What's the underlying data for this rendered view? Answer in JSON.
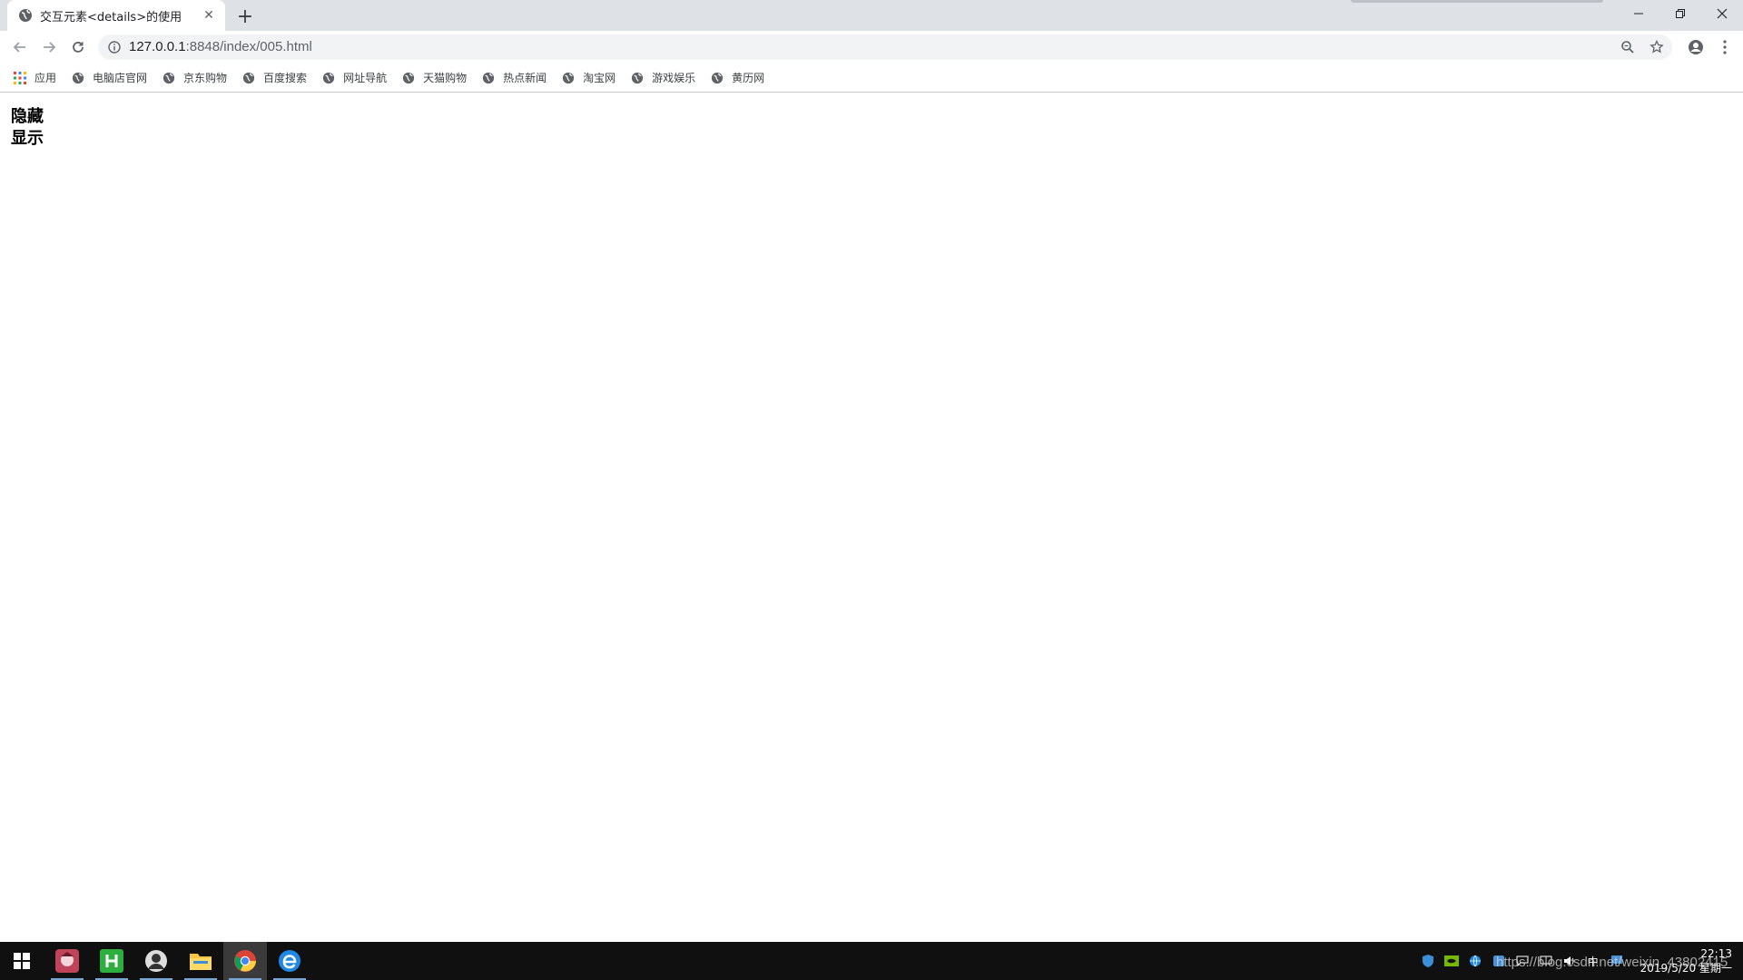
{
  "browser": {
    "tab": {
      "title": "交互元素<details>的使用"
    },
    "address": {
      "host": "127.0.0.1",
      "path": ":8848/index/005.html"
    }
  },
  "bookmarks": [
    {
      "label": "应用",
      "icon": "apps-grid-icon"
    },
    {
      "label": "电脑店官网",
      "icon": "globe-icon"
    },
    {
      "label": "京东购物",
      "icon": "globe-icon"
    },
    {
      "label": "百度搜索",
      "icon": "globe-icon"
    },
    {
      "label": "网址导航",
      "icon": "globe-icon"
    },
    {
      "label": "天猫购物",
      "icon": "globe-icon"
    },
    {
      "label": "热点新闻",
      "icon": "globe-icon"
    },
    {
      "label": "淘宝网",
      "icon": "globe-icon"
    },
    {
      "label": "游戏娱乐",
      "icon": "globe-icon"
    },
    {
      "label": "黄历网",
      "icon": "globe-icon"
    }
  ],
  "page": {
    "summaries": [
      {
        "label": "隐藏"
      },
      {
        "label": "显示"
      }
    ]
  },
  "taskbar": {
    "clock": {
      "time": "22:13",
      "date": "2019/5/20 星期一"
    },
    "ime": "中",
    "watermark": "https://blog.csdn.net/weixin_43802415"
  }
}
